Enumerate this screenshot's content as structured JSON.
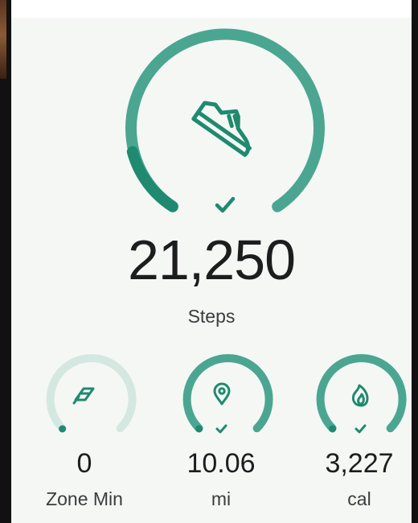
{
  "steps": {
    "value": "21,250",
    "label": "Steps",
    "icon": "shoe-icon",
    "goal_met_icon": "check-icon",
    "progress": 1.0
  },
  "metrics": [
    {
      "value": "0",
      "label": "Zone Min",
      "icon": "zone-minutes-icon",
      "progress": 0.0
    },
    {
      "value": "10.06",
      "label": "mi",
      "icon": "location-pin-icon",
      "goal_met_icon": "check-icon",
      "progress": 1.0
    },
    {
      "value": "3,227",
      "label": "cal",
      "icon": "flame-icon",
      "goal_met_icon": "check-icon",
      "progress": 1.0
    }
  ],
  "colors": {
    "accent": "#4ba691",
    "accent_dark": "#1f8a6f",
    "track_light": "#d4e8e2",
    "background": "#f5f7f5"
  }
}
